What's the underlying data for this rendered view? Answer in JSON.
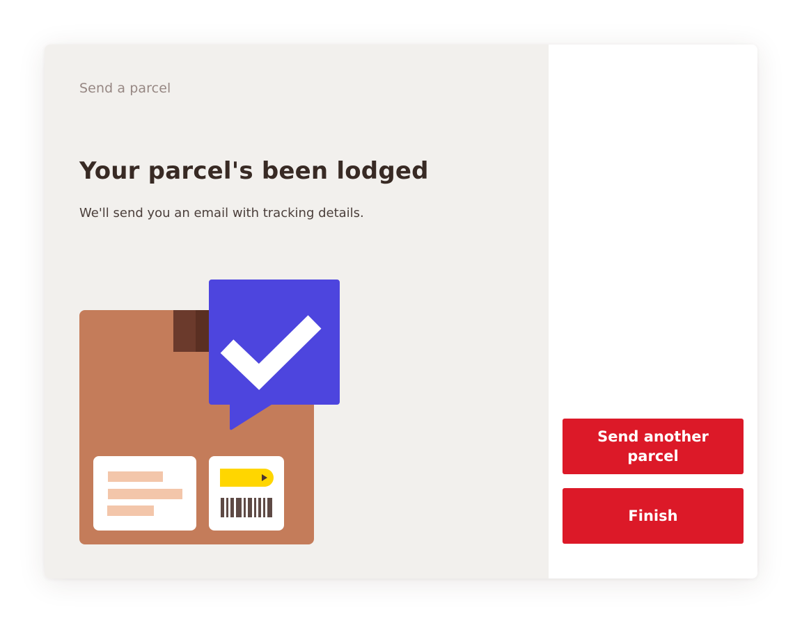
{
  "header": {
    "breadcrumb": "Send a parcel"
  },
  "main": {
    "title": "Your parcel's been lodged",
    "subtitle": "We'll send you an email with tracking details."
  },
  "actions": {
    "send_another_label": "Send another parcel",
    "finish_label": "Finish"
  },
  "colors": {
    "panel_bg": "#f2f0ed",
    "accent_red": "#dc1928",
    "check_bubble": "#4d45de",
    "box": "#c47c5a",
    "tape": "#6b3a2c",
    "label_stripe": "#f3c6aa",
    "yellow_tag": "#ffd600",
    "title_text": "#382a24"
  },
  "icons": {
    "illustration": "parcel-with-checkmark-illustration",
    "check": "check-icon",
    "barcode": "barcode-icon"
  }
}
